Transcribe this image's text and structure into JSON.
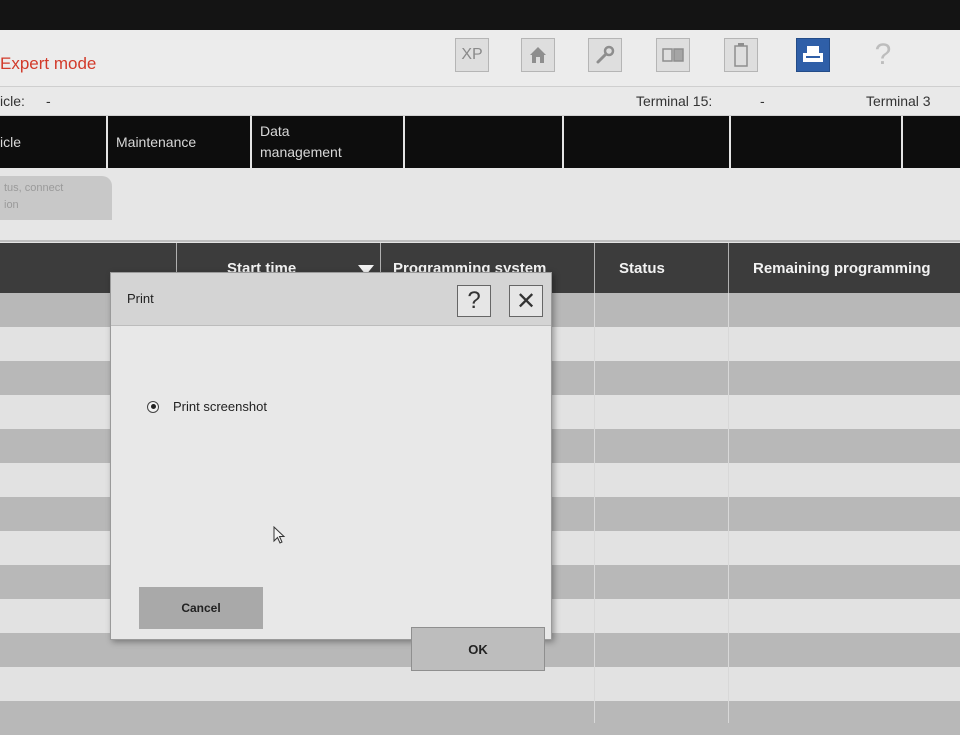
{
  "app": {
    "title": "Expert mode",
    "toolbar": [
      {
        "name": "xp-button",
        "label": "XP"
      },
      {
        "name": "home-button",
        "icon": "home-icon"
      },
      {
        "name": "wrench-button",
        "icon": "wrench-icon"
      },
      {
        "name": "display-button",
        "icon": "display-icon"
      },
      {
        "name": "battery-button",
        "icon": "battery-icon"
      },
      {
        "name": "print-button",
        "icon": "printer-icon",
        "active": true
      },
      {
        "name": "help-button",
        "label": "?"
      }
    ],
    "accent_color": "#2f5fa8",
    "title_color": "#d23a2a"
  },
  "info": {
    "vehicle_label": "icle:",
    "vehicle_value": "-",
    "terminal15_label": "Terminal 15:",
    "terminal15_value": "-",
    "terminal30_label": "Terminal 3"
  },
  "nav": {
    "tabs": [
      "icle",
      "Maintenance",
      "Data management",
      "",
      "",
      "",
      ""
    ]
  },
  "subtab": {
    "label_line1": "tus, connect",
    "label_line2": "ion"
  },
  "table": {
    "headers": [
      "",
      "Start time",
      "Programming system",
      "Status",
      "Remaining programming"
    ]
  },
  "dialog": {
    "title": "Print",
    "help_label": "?",
    "close_label": "✕",
    "option_label": "Print screenshot",
    "cancel_label": "Cancel",
    "ok_label": "OK"
  }
}
